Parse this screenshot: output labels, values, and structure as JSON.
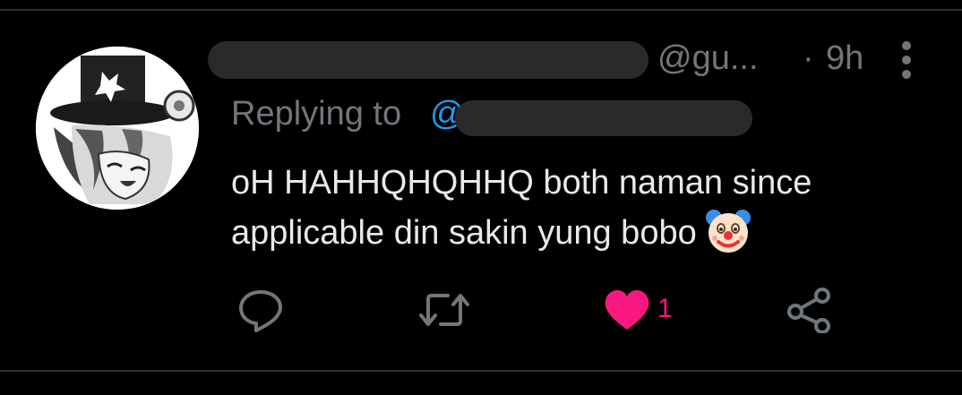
{
  "tweet": {
    "handle": "@gu...",
    "time_separator": "·",
    "time": "9h",
    "replying_label": "Replying to",
    "replying_at": "@",
    "text": "oH HAHHQHQHHQ both naman since applicable din sakin yung bobo",
    "emoji": "clown-face-emoji"
  },
  "actions": {
    "reply_icon": "reply-icon",
    "retweet_icon": "retweet-icon",
    "like_icon": "heart-icon",
    "like_count": "1",
    "share_icon": "share-icon"
  },
  "colors": {
    "background": "#000000",
    "text": "#e7e9ea",
    "muted": "#71767b",
    "link": "#1d9bf0",
    "like": "#f91880",
    "divider": "#2f3336"
  }
}
